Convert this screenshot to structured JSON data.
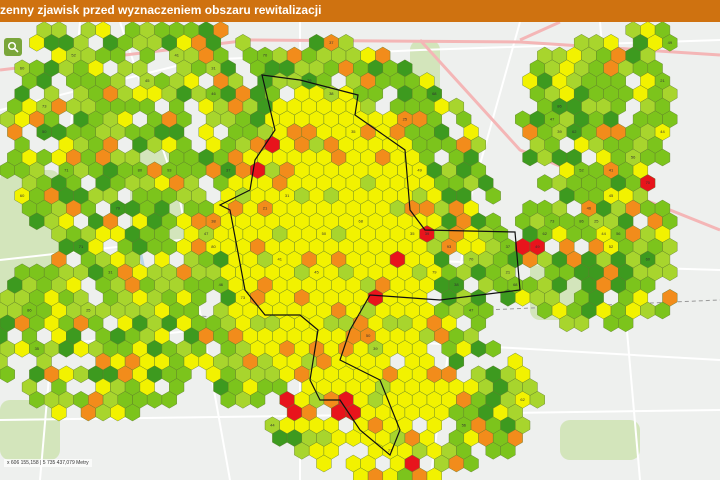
{
  "header": {
    "title": "zenny zjawisk przed wyznaczeniem obszaru rewitalizacji"
  },
  "map": {
    "coordinates": "x 606 155,158 | 5 735 437,079 Metry",
    "colors": {
      "background": "#eef0ee",
      "road": "#ffffff",
      "road_major": "#f4b6b6",
      "park": "#cfe3b5",
      "water": "#b9d7ea",
      "boundary": "#111111",
      "hex_stroke": "#5a7a2a",
      "dark_green": "#3d9a1f",
      "green": "#7cc41c",
      "light_green": "#a8d52d",
      "yellow": "#f2f200",
      "orange": "#f28c1b",
      "red": "#e8141c"
    },
    "legend_note": "",
    "zoom_icon": "search-icon"
  }
}
